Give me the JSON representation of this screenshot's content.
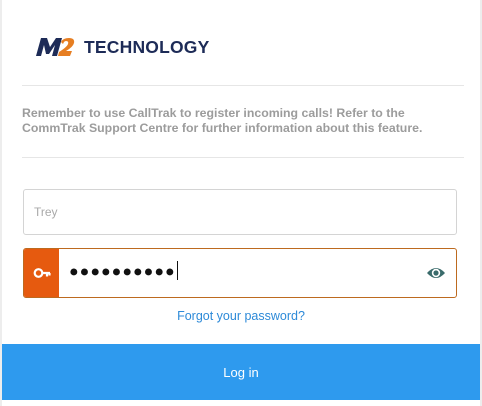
{
  "brand": {
    "logo_text": "TECHNOLOGY",
    "mark_text": "M2"
  },
  "notice": {
    "text": "Remember to use CallTrak to register incoming calls! Refer to the CommTrak Support Centre for further information about this feature."
  },
  "username": {
    "value": "Trey"
  },
  "password": {
    "masked_value": "●●●●●●●●●●",
    "icon": "key-icon",
    "toggle_icon": "eye-icon"
  },
  "links": {
    "forgot_password": "Forgot your password?"
  },
  "actions": {
    "login_label": "Log in"
  },
  "colors": {
    "brand_navy": "#1d2b57",
    "brand_orange": "#e67e22",
    "accent_orange": "#e65a0f",
    "primary_blue": "#2e9aee",
    "link_blue": "#2d8ad8"
  }
}
